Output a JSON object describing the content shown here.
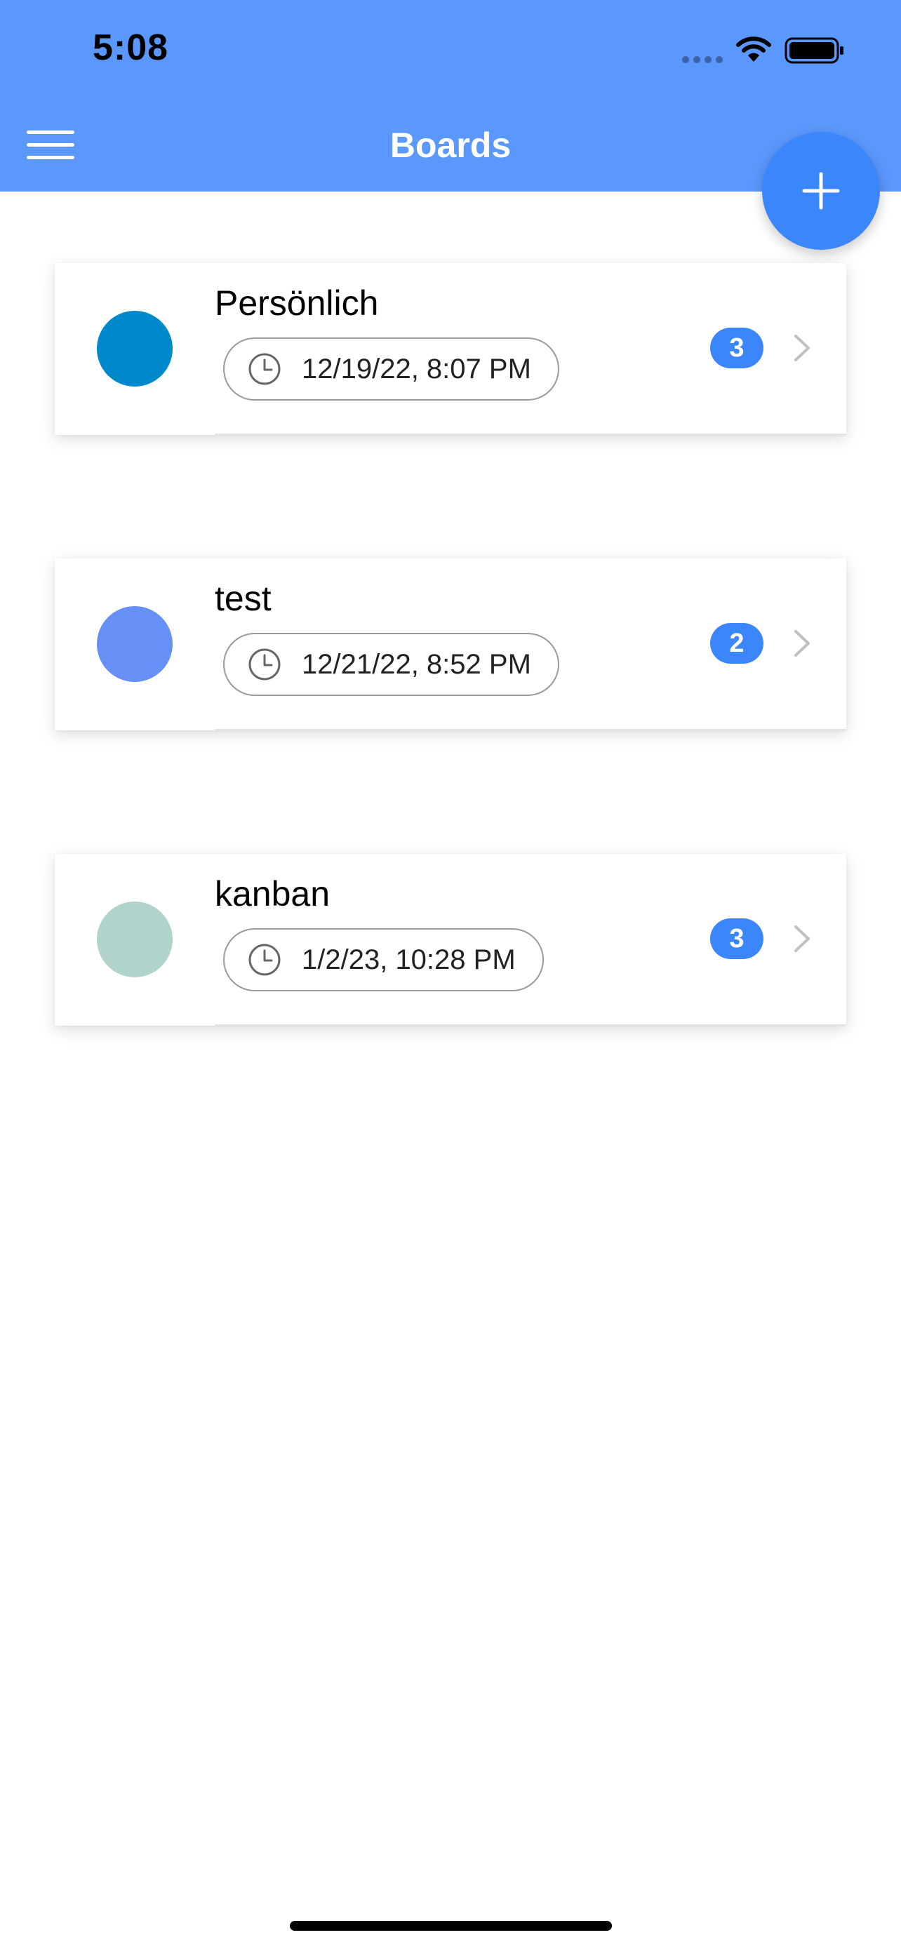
{
  "status_bar": {
    "time": "5:08"
  },
  "header": {
    "title": "Boards",
    "background_color": "#5b98fd"
  },
  "fab": {
    "icon": "plus-icon",
    "color": "#3c86fb"
  },
  "boards": [
    {
      "name": "Persönlich",
      "date": "12/19/22, 8:07 PM",
      "count": "3",
      "color": "#0088cc"
    },
    {
      "name": "test",
      "date": "12/21/22, 8:52 PM",
      "count": "2",
      "color": "#6690f5"
    },
    {
      "name": "kanban",
      "date": "1/2/23, 10:28 PM",
      "count": "3",
      "color": "#b1d3cc"
    }
  ],
  "colors": {
    "accent": "#3c86fb",
    "chip_border": "#9a9a9a",
    "chevron": "#c0c0c0"
  }
}
